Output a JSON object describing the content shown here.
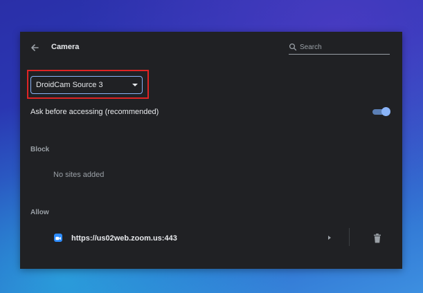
{
  "header": {
    "title": "Camera",
    "search_placeholder": "Search"
  },
  "camera_select": {
    "value": "DroidCam Source 3"
  },
  "ask_before_accessing": {
    "label": "Ask before accessing (recommended)",
    "enabled": true
  },
  "block": {
    "heading": "Block",
    "empty_text": "No sites added"
  },
  "allow": {
    "heading": "Allow",
    "sites": [
      {
        "url": "https://us02web.zoom.us:443",
        "icon": "zoom-icon"
      }
    ]
  },
  "colors": {
    "accent": "#8ab4f8",
    "panel_bg": "#202124",
    "highlight": "#e02424",
    "zoom_blue": "#2d8cff"
  }
}
